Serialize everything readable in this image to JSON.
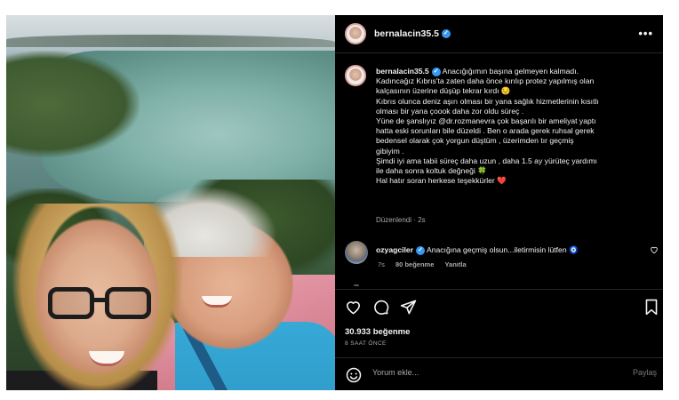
{
  "post": {
    "username": "bernalacin35.5",
    "more_label": "•••",
    "caption_lines": [
      "Anacığığımın başına gelmeyen kalmadı.",
      "Kadıncağız Kıbrıs'ta zaten daha önce kırılıp protez yapılmış olan",
      "kalçasının üzerine düşüp tekrar kırdı 😔",
      "Kıbrıs olunca deniz aşırı olması bir yana sağlık hizmetlerinin kısıtlı",
      "olması bir yana çoook daha zor oldu süreç .",
      "Yüne de şanslıyız @dr.rozmanevra çok başarılı bir ameliyat yaptı",
      "hatta eski sorunları bile düzeldi . Ben o arada gerek ruhsal gerek",
      "bedensel olarak çok yorgun düştüm , üzerimden tır geçmiş",
      "gibiyim .",
      "Şimdi iyi ama tabii süreç daha uzun , daha 1.5 ay yürüteç yardımı",
      "ile daha sonra koltuk değneği 🍀",
      "Hal hatır soran herkese teşekkürler ❤️"
    ],
    "edited_label": "Düzenlendi · 2s"
  },
  "comment": {
    "username": "ozyagciler",
    "text": "Anacığına geçmiş olsun...iletirmisin lütfen 🧿",
    "time": "7s",
    "likes": "80 beğenme",
    "reply": "Yanıtla"
  },
  "stats": {
    "likes": "30.933 beğenme",
    "time": "8 SAAT ÖNCE"
  },
  "composer": {
    "placeholder": "Yorum ekle...",
    "post_label": "Paylaş"
  },
  "colors": {
    "panel_bg": "#000000",
    "verified": "#3897f0",
    "muted_text": "#a8a8a8",
    "divider": "#262626"
  },
  "icons": [
    "heart-icon",
    "comment-icon",
    "share-icon",
    "bookmark-icon",
    "emoji-icon",
    "verified-icon",
    "more-icon"
  ]
}
